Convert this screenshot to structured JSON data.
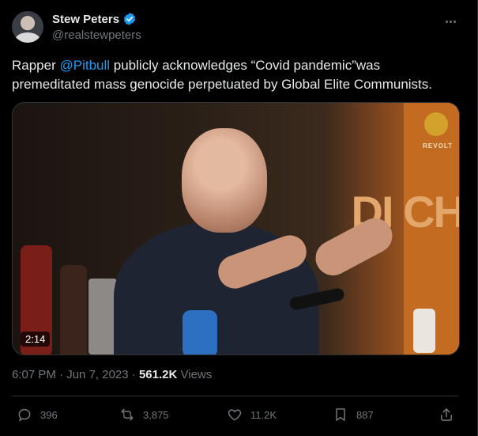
{
  "author": {
    "name": "Stew Peters",
    "handle": "@realstewpeters",
    "verified": true
  },
  "tweet": {
    "text_before": "Rapper ",
    "mention": "@Pitbull",
    "text_after": " publicly acknowledges “Covid pandemic”was premeditated mass genocide perpetuated by Global Elite Communists."
  },
  "media": {
    "duration": "2:14",
    "watermark": "REVOLT",
    "banner_text": "DI CH"
  },
  "meta": {
    "time": "6:07 PM",
    "separator": "·",
    "date": "Jun 7, 2023",
    "views_count": "561.2K",
    "views_label": "Views"
  },
  "actions": {
    "replies": "396",
    "reposts": "3,875",
    "likes": "11.2K",
    "bookmarks": "887"
  },
  "colors": {
    "background": "#000000",
    "accent": "#1d9bf0",
    "muted": "#71767b",
    "text": "#e7e9ea"
  },
  "icons": [
    "verified-badge-icon",
    "more-icon",
    "reply-icon",
    "repost-icon",
    "like-icon",
    "bookmark-icon",
    "share-icon"
  ]
}
